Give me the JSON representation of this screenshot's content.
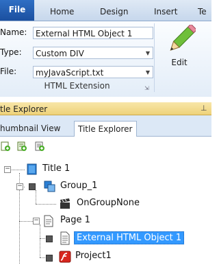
{
  "ribbon": {
    "tabs": [
      "File",
      "Home",
      "Design",
      "Insert",
      "Te"
    ],
    "fields": {
      "name_label": "Name:",
      "name_value": "External HTML Object 1",
      "type_label": "Type:",
      "type_value": "Custom DIV",
      "file_label": "File:",
      "file_value": "myJavaScript.txt"
    },
    "edit_label": "Edit",
    "group_label": "HTML Extension"
  },
  "explorer": {
    "title": "tle Explorer",
    "tabs": [
      "humbnail View",
      "Title Explorer"
    ],
    "tree": [
      {
        "label": "Title 1"
      },
      {
        "label": "Group_1"
      },
      {
        "label": "OnGroupNone"
      },
      {
        "label": "Page 1"
      },
      {
        "label": "External HTML Object 1"
      },
      {
        "label": "Project1"
      }
    ]
  },
  "colors": {
    "accent": "#2f6fc4",
    "selection": "#3399ff",
    "explorer_header": "#f1d98a"
  }
}
